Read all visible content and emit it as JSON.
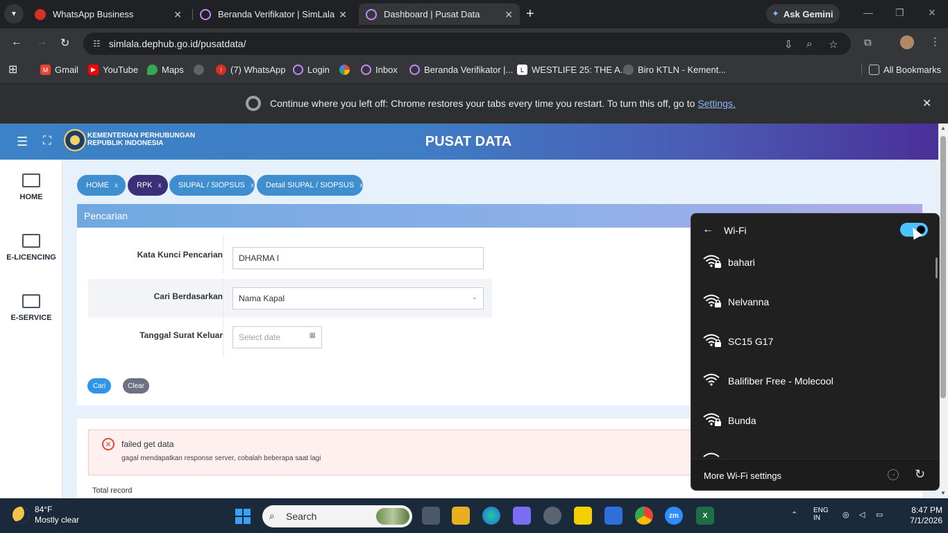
{
  "browser": {
    "tabs": [
      {
        "title": "WhatsApp Business",
        "active": false
      },
      {
        "title": "Beranda Verifikator | SimLala",
        "active": false
      },
      {
        "title": "Dashboard | Pusat Data",
        "active": true
      }
    ],
    "gemini_label": "Ask Gemini",
    "url": "simlala.dephub.go.id/pusatdata/",
    "bookmarks": [
      "Gmail",
      "YouTube",
      "Maps",
      "(7) WhatsApp",
      "Login",
      "Inbox",
      "Beranda Verifikator |...",
      "WESTLIFE 25: THE A...",
      "Biro KTLN - Kement..."
    ],
    "all_bookmarks": "All Bookmarks",
    "restore_message": "Continue where you left off: Chrome restores your tabs every time you restart. To turn this off, go to",
    "restore_link": "Settings."
  },
  "app": {
    "ministry_line1": "KEMENTERIAN PERHUBUNGAN",
    "ministry_line2": "REPUBLIK INDONESIA",
    "title": "PUSAT DATA",
    "sidebar": [
      {
        "label": "HOME"
      },
      {
        "label": "E-LICENCING"
      },
      {
        "label": "E-SERVICE"
      }
    ],
    "breadcrumbs": [
      {
        "label": "HOME",
        "close": "x",
        "active": false
      },
      {
        "label": "RPK",
        "close": "x",
        "active": true
      },
      {
        "label": "SIUPAL / SIOPSUS",
        "close": "x",
        "active": false
      },
      {
        "label": "Detail SIUPAL / SIOPSUS",
        "close": "x",
        "active": false
      }
    ],
    "search_panel": {
      "title": "Pencarian",
      "keyword_label": "Kata Kunci Pencarian",
      "keyword_value": "DHARMA I",
      "search_by_label": "Cari Berdasarkan",
      "search_by_value": "Nama Kapal",
      "date_label": "Tanggal Surat Keluar",
      "date_placeholder": "Select date",
      "search_button": "Cari",
      "clear_button": "Clear"
    },
    "alert": {
      "title": "failed get data",
      "detail": "gagal mendapatkan response server, cobalah beberapa saat lagi"
    },
    "total_record_label": "Total record"
  },
  "wifi_flyout": {
    "title": "Wi-Fi",
    "enabled": true,
    "networks": [
      {
        "name": "bahari",
        "secured": true
      },
      {
        "name": "Nelvanna",
        "secured": true
      },
      {
        "name": "SC15 G17",
        "secured": true
      },
      {
        "name": "Balifiber Free - Molecool",
        "secured": false
      },
      {
        "name": "Bunda",
        "secured": true
      }
    ],
    "more_settings": "More Wi-Fi settings"
  },
  "taskbar": {
    "temperature": "84°F",
    "condition": "Mostly clear",
    "search_placeholder": "Search",
    "lang_line1": "ENG",
    "lang_line2": "IN",
    "time": "8:47 PM",
    "date": "7/1/2026"
  },
  "colors": {
    "accent_blue": "#3e8ed0",
    "active_crumb": "#3b2f7a",
    "wifi_toggle": "#4cc2ff",
    "error": "#e04b3c"
  }
}
